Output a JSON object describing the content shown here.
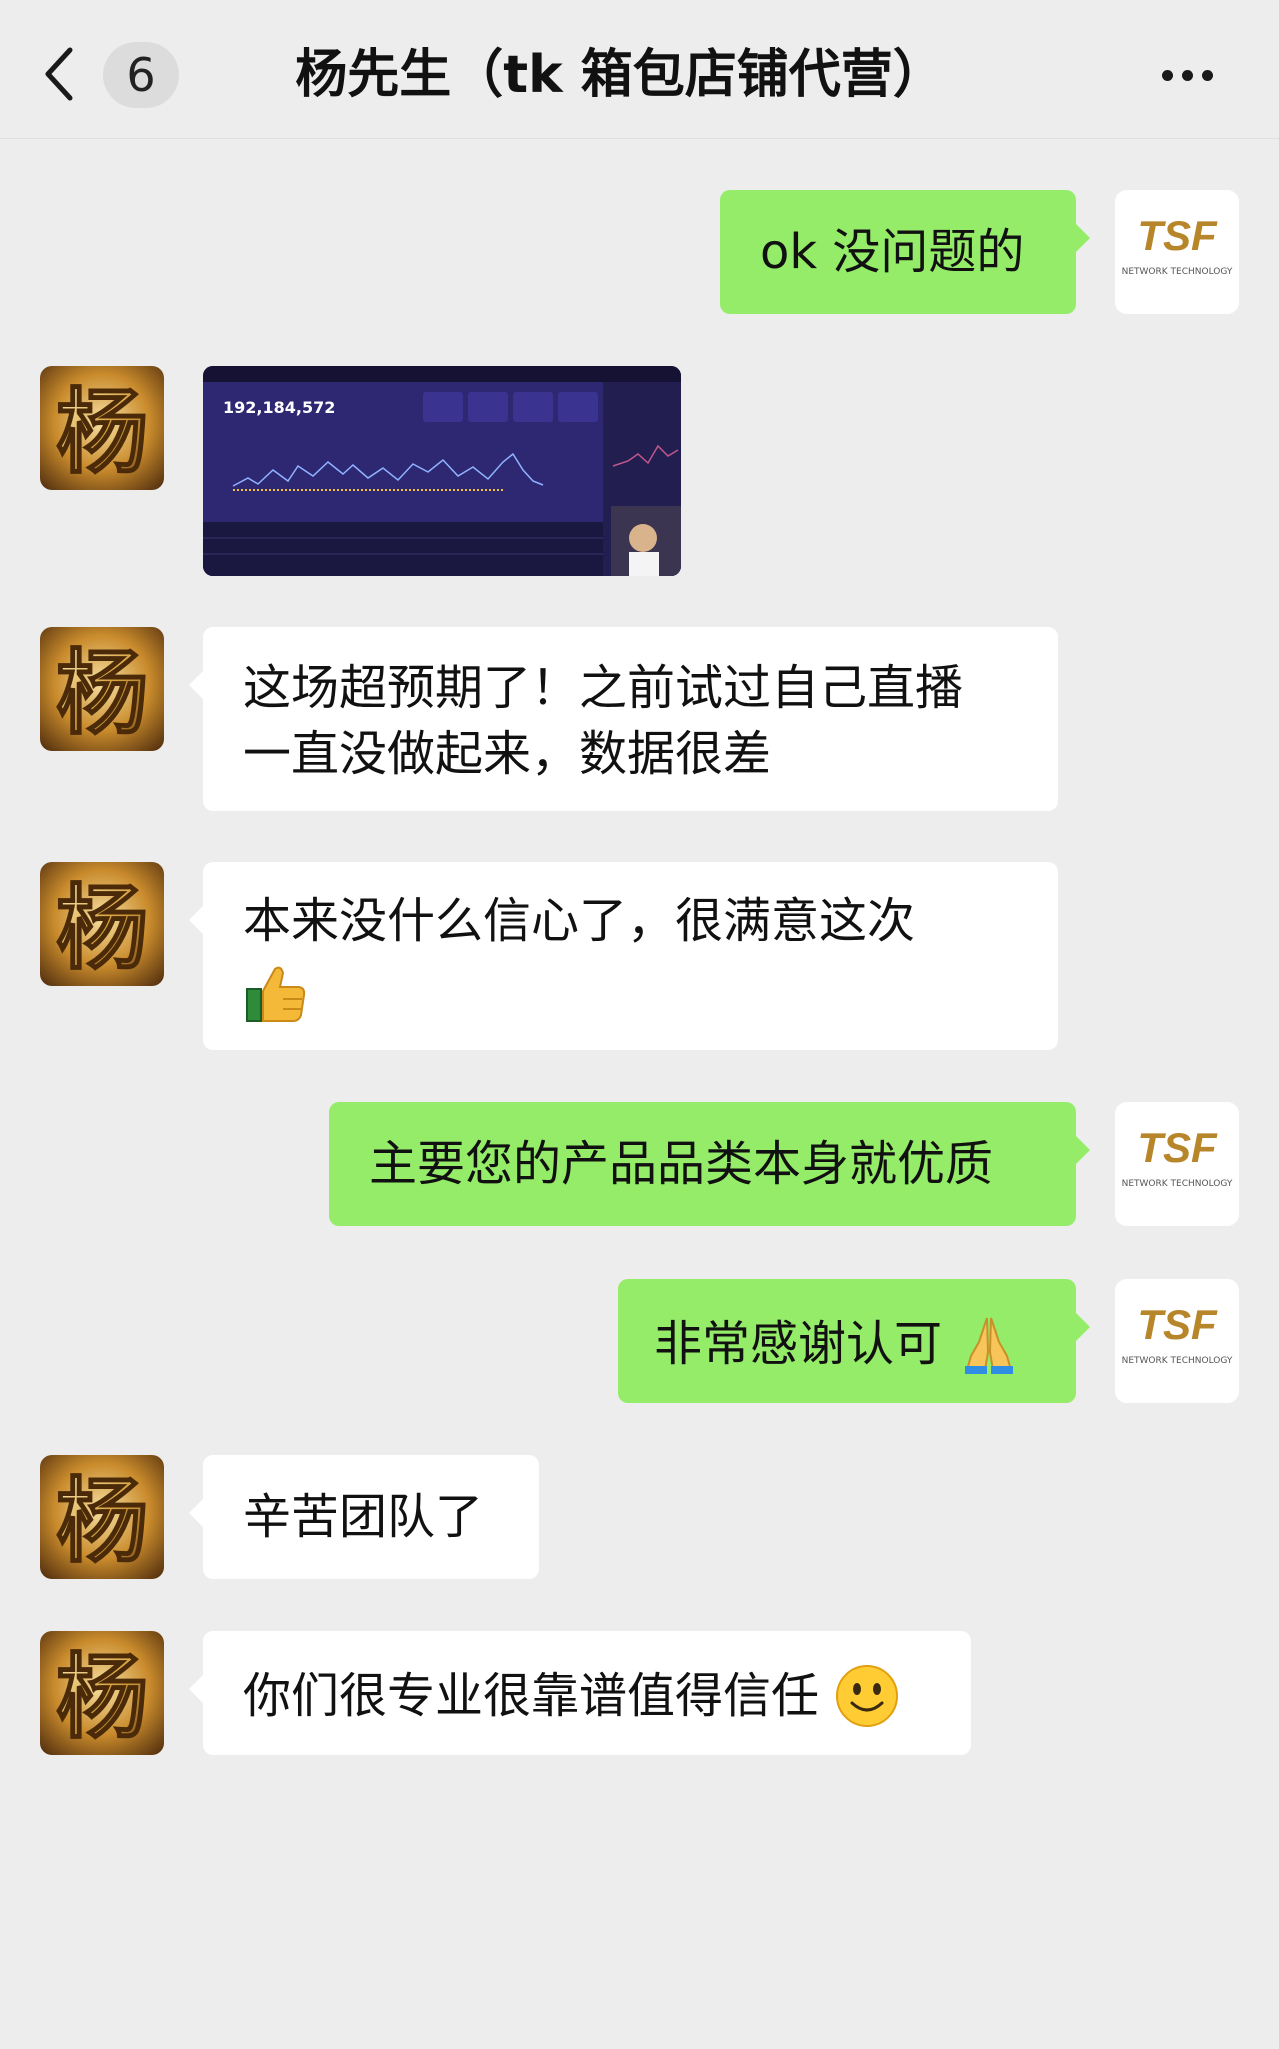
{
  "header": {
    "back_icon": "chevron-left-icon",
    "unread_count": "6",
    "title": "杨先生（tk 箱包店铺代营）",
    "more_icon": "more-dots-icon"
  },
  "colors": {
    "background": "#ededed",
    "bubble_self": "#95ec69",
    "bubble_other": "#ffffff",
    "logo_gold": "#b8862a"
  },
  "contacts": {
    "other": {
      "avatar_glyph": "杨"
    },
    "self": {
      "logo_text": "TSF",
      "logo_subtext": "NETWORK  TECHNOLOGY"
    }
  },
  "messages": [
    {
      "side": "right",
      "text": "ok 没问题的"
    },
    {
      "side": "left",
      "type": "image",
      "screenshot_value": "192,184,572"
    },
    {
      "side": "left",
      "line1": "这场超预期了！之前试过自己直播",
      "line2": "一直没做起来，数据很差"
    },
    {
      "side": "left",
      "line1": "本来没什么信心了，很满意这次",
      "emoji": "thumbs-up-icon"
    },
    {
      "side": "right",
      "text": "主要您的产品品类本身就优质"
    },
    {
      "side": "right",
      "text": "非常感谢认可",
      "emoji": "folded-hands-icon"
    },
    {
      "side": "left",
      "text": "辛苦团队了"
    },
    {
      "side": "left",
      "text": "你们很专业很靠谱值得信任",
      "emoji": "smiling-face-icon"
    }
  ]
}
